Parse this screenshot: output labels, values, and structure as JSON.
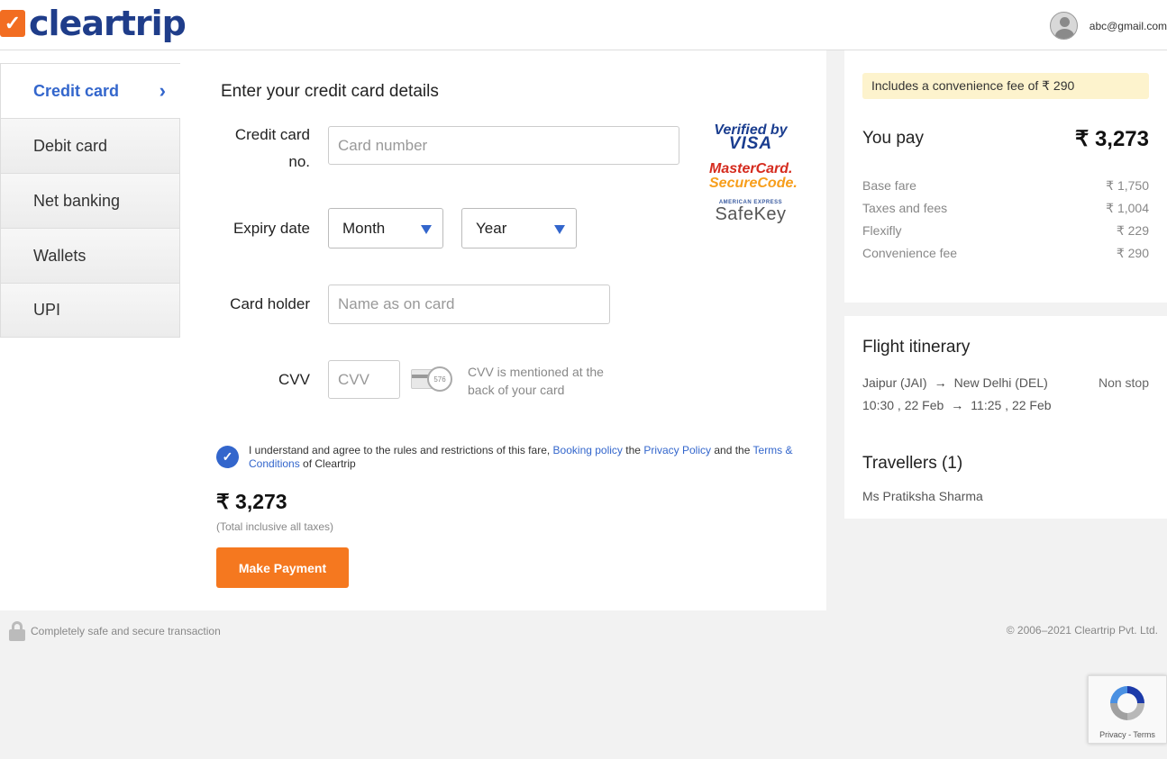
{
  "header": {
    "logo_text": "cleartrip",
    "user_email": "abc@gmail.com"
  },
  "tabs": [
    {
      "label": "Credit card",
      "active": true
    },
    {
      "label": "Debit card",
      "active": false
    },
    {
      "label": "Net banking",
      "active": false
    },
    {
      "label": "Wallets",
      "active": false
    },
    {
      "label": "UPI",
      "active": false
    }
  ],
  "form": {
    "title": "Enter your credit card details",
    "card_number_label_line1": "Credit card",
    "card_number_label_line2": "no.",
    "card_number_placeholder": "Card number",
    "expiry_label": "Expiry date",
    "month_value": "Month",
    "year_value": "Year",
    "holder_label": "Card holder",
    "holder_placeholder": "Name as on card",
    "cvv_label": "CVV",
    "cvv_placeholder": "CVV",
    "cvv_card_number": "576",
    "cvv_hint": "CVV is mentioned at the back of your card"
  },
  "badges": {
    "visa_top": "Verified by",
    "visa_bottom": "VISA",
    "mc_top": "MasterCard.",
    "mc_bottom": "SecureCode.",
    "safekey_top": "AMERICAN EXPRESS",
    "safekey_bottom": "SafeKey"
  },
  "agreement": {
    "text_1": "I understand and agree to the rules and restrictions of this fare,",
    "link_booking": "Booking policy",
    "text_2": "the",
    "link_privacy": "Privacy Policy",
    "text_3": "and the",
    "link_terms": "Terms & Conditions",
    "text_4": "of Cleartrip"
  },
  "payment": {
    "total": "₹ 3,273",
    "total_sub": "(Total inclusive all taxes)",
    "button_label": "Make Payment"
  },
  "summary": {
    "fee_note": "Includes a convenience fee of ₹ 290",
    "you_pay_label": "You pay",
    "you_pay_amount": "₹ 3,273",
    "rows": [
      {
        "label": "Base fare",
        "value": "₹ 1,750"
      },
      {
        "label": "Taxes and fees",
        "value": "₹ 1,004"
      },
      {
        "label": "Flexifly",
        "value": "₹ 229"
      },
      {
        "label": "Convenience fee",
        "value": "₹ 290"
      }
    ]
  },
  "itinerary": {
    "title": "Flight itinerary",
    "from": "Jaipur (JAI)",
    "to": "New Delhi (DEL)",
    "depart": "10:30 , 22 Feb",
    "arrive": "11:25 , 22 Feb",
    "stops": "Non stop",
    "travellers_title": "Travellers (1)",
    "traveller_name": "Ms Pratiksha Sharma"
  },
  "footer": {
    "secure_text": "Completely safe and secure transaction",
    "copyright": "© 2006–2021 Cleartrip Pvt. Ltd."
  },
  "recaptcha": {
    "links": "Privacy - Terms"
  },
  "colors": {
    "brand_orange": "#f26d21",
    "brand_blue": "#1f3d8a",
    "link_blue": "#3366cc",
    "button_orange": "#f5781f"
  }
}
